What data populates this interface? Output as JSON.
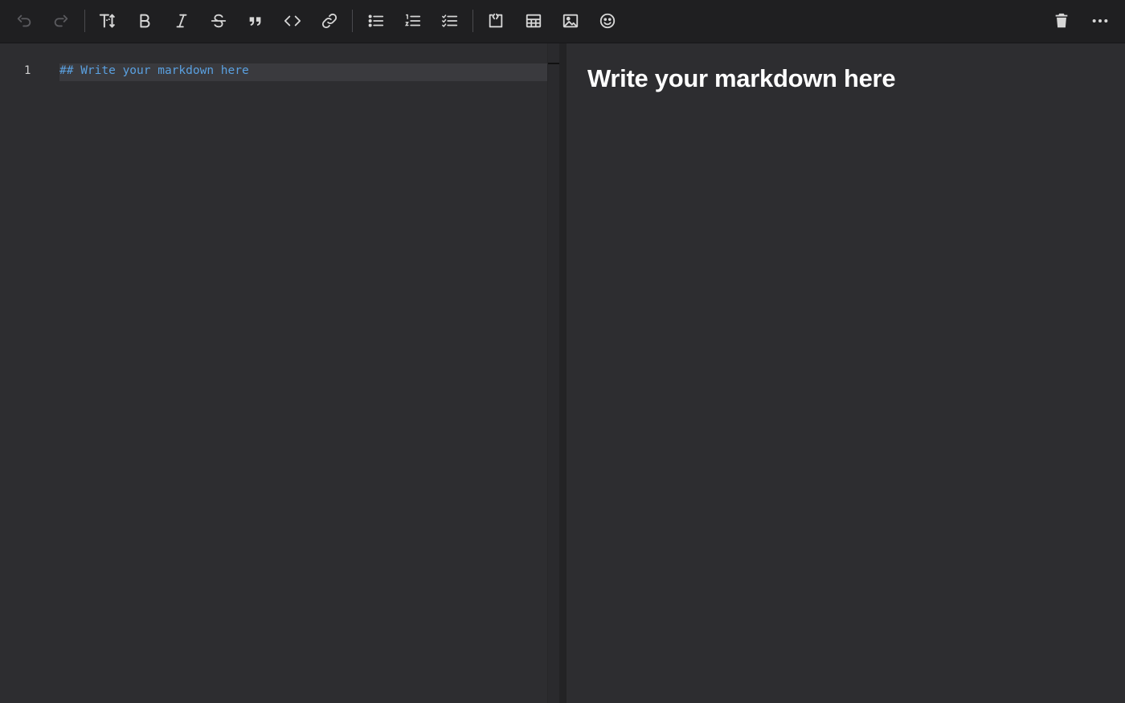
{
  "toolbar": {
    "icons": {
      "undo": "undo-icon",
      "redo": "redo-icon",
      "heading": "heading-icon",
      "bold": "bold-icon",
      "italic": "italic-icon",
      "strike": "strikethrough-icon",
      "quote": "quote-icon",
      "code": "code-icon",
      "link": "link-icon",
      "bullet_list": "bullet-list-icon",
      "ordered_list": "ordered-list-icon",
      "task_list": "task-list-icon",
      "code_block": "code-block-icon",
      "table": "table-icon",
      "image": "image-icon",
      "emoji": "emoji-icon",
      "trash": "trash-icon",
      "more": "more-icon"
    },
    "heading_label": "T↕",
    "bold_label": "B",
    "italic_label": "I"
  },
  "editor": {
    "line_number": "1",
    "line_text": "## Write your markdown here"
  },
  "preview": {
    "heading": "Write your markdown here"
  },
  "colors": {
    "background": "#2d2d30",
    "toolbar": "#1f1f21",
    "syntax_heading": "#5aa0e0",
    "preview_text": "#ffffff"
  }
}
